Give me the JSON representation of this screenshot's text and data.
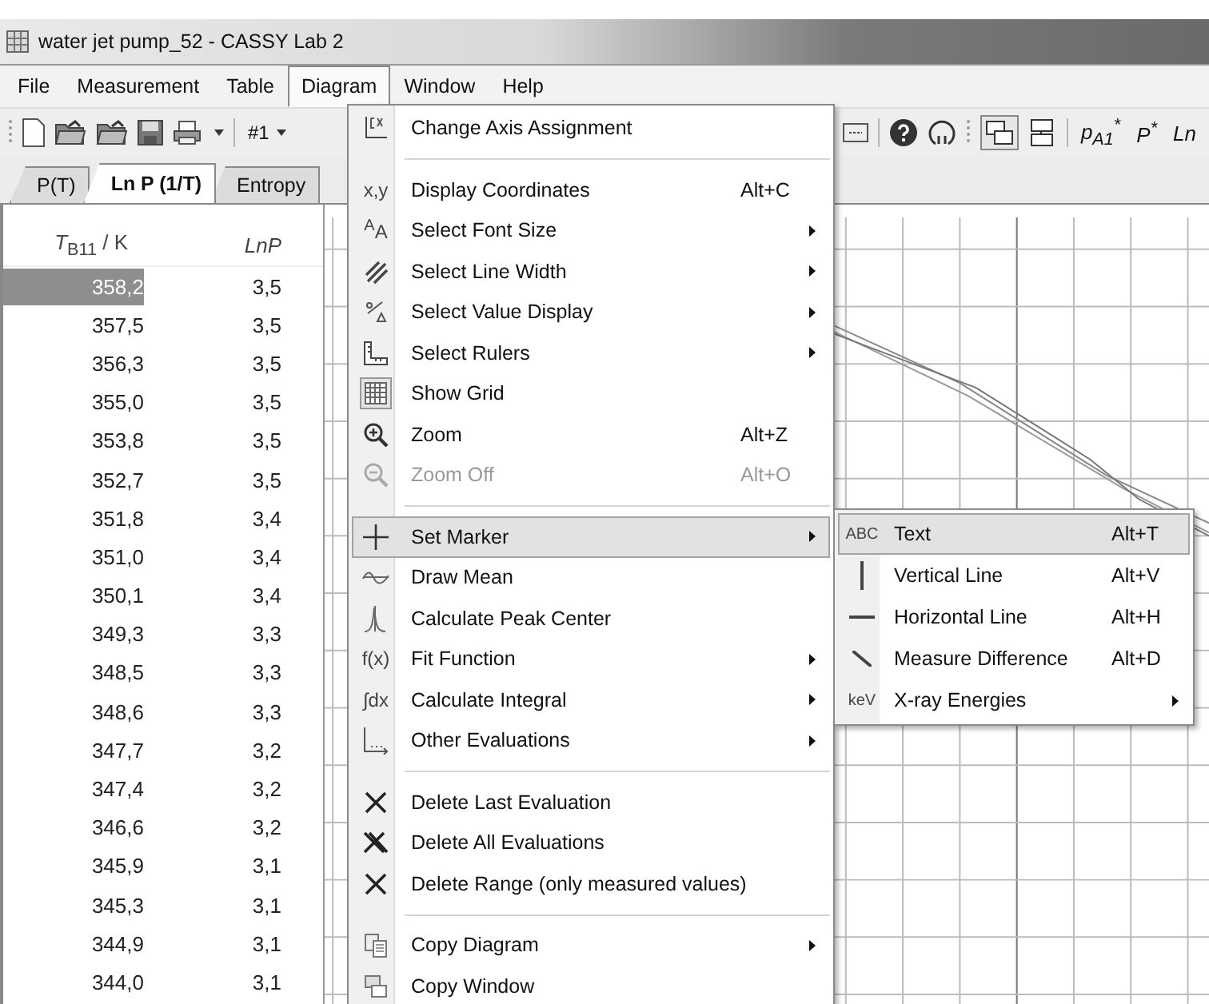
{
  "window": {
    "title": "water jet pump_52 - CASSY Lab 2"
  },
  "menu_bar": [
    {
      "label": "File",
      "selected": false
    },
    {
      "label": "Measurement",
      "selected": false
    },
    {
      "label": "Table",
      "selected": false
    },
    {
      "label": "Diagram",
      "selected": true
    },
    {
      "label": "Window",
      "selected": false
    },
    {
      "label": "Help",
      "selected": false
    }
  ],
  "toolbar": {
    "set_selector": "#1",
    "quantities": [
      "p$_{A1}$$^{*}$",
      "P$^{*}$",
      "Ln"
    ]
  },
  "tabs": [
    {
      "label": "P(T)",
      "selected": false
    },
    {
      "label": "Ln P (1/T)",
      "selected": true
    },
    {
      "label": "Entropy",
      "selected": false
    }
  ],
  "table": {
    "columns": [
      {
        "label": "*T*$_{B11}$ / K",
        "italic": false
      },
      {
        "label": "LnP",
        "italic": true
      }
    ],
    "rows": [
      {
        "cells": [
          "358,2",
          "3,5"
        ],
        "selected": true
      },
      {
        "cells": [
          "357,5",
          "3,5"
        ],
        "selected": false
      },
      {
        "cells": [
          "356,3",
          "3,5"
        ],
        "selected": false
      },
      {
        "cells": [
          "355,0",
          "3,5"
        ],
        "selected": false
      },
      {
        "cells": [
          "353,8",
          "3,5"
        ],
        "selected": false
      },
      {
        "cells": [
          "352,7",
          "3,5"
        ],
        "selected": false
      },
      {
        "cells": [
          "351,8",
          "3,4"
        ],
        "selected": false
      },
      {
        "cells": [
          "351,0",
          "3,4"
        ],
        "selected": false
      },
      {
        "cells": [
          "350,1",
          "3,4"
        ],
        "selected": false
      },
      {
        "cells": [
          "349,3",
          "3,3"
        ],
        "selected": false
      },
      {
        "cells": [
          "348,5",
          "3,3"
        ],
        "selected": false
      },
      {
        "cells": [
          "348,6",
          "3,3"
        ],
        "selected": false
      },
      {
        "cells": [
          "347,7",
          "3,2"
        ],
        "selected": false
      },
      {
        "cells": [
          "347,4",
          "3,2"
        ],
        "selected": false
      },
      {
        "cells": [
          "346,6",
          "3,2"
        ],
        "selected": false
      },
      {
        "cells": [
          "345,9",
          "3,1"
        ],
        "selected": false
      },
      {
        "cells": [
          "345,3",
          "3,1"
        ],
        "selected": false
      },
      {
        "cells": [
          "344,9",
          "3,1"
        ],
        "selected": false
      },
      {
        "cells": [
          "344,0",
          "3,1"
        ],
        "selected": false
      }
    ]
  },
  "diagram_menu": {
    "items": [
      {
        "kind": "item",
        "label": "Change Axis Assignment",
        "submenu": false,
        "disabled": false,
        "checked": false,
        "selected": false
      },
      {
        "kind": "separator"
      },
      {
        "kind": "item",
        "label": "Display Coordinates",
        "icon_text": "x,y",
        "shortcut": "Alt+C",
        "submenu": false,
        "disabled": false,
        "checked": false,
        "selected": false
      },
      {
        "kind": "item",
        "label": "Select Font Size",
        "icon_text": "$^{A}$A",
        "submenu": true,
        "disabled": false,
        "checked": false,
        "selected": false
      },
      {
        "kind": "item",
        "label": "Select Line Width",
        "submenu": true,
        "disabled": false,
        "checked": false,
        "selected": false
      },
      {
        "kind": "item",
        "label": "Select Value Display",
        "submenu": true,
        "disabled": false,
        "checked": false,
        "selected": false
      },
      {
        "kind": "item",
        "label": "Select Rulers",
        "submenu": true,
        "disabled": false,
        "checked": false,
        "selected": false
      },
      {
        "kind": "item",
        "label": "Show Grid",
        "submenu": false,
        "disabled": false,
        "checked": true,
        "selected": false
      },
      {
        "kind": "item",
        "label": "Zoom",
        "shortcut": "Alt+Z",
        "submenu": false,
        "disabled": false,
        "checked": false,
        "selected": false
      },
      {
        "kind": "item",
        "label": "Zoom Off",
        "shortcut": "Alt+O",
        "submenu": false,
        "disabled": true,
        "checked": false,
        "selected": false
      },
      {
        "kind": "separator"
      },
      {
        "kind": "item",
        "label": "Set Marker",
        "submenu": true,
        "disabled": false,
        "checked": false,
        "selected": true
      },
      {
        "kind": "item",
        "label": "Draw Mean",
        "submenu": false,
        "disabled": false,
        "checked": false,
        "selected": false
      },
      {
        "kind": "item",
        "label": "Calculate Peak Center",
        "submenu": false,
        "disabled": false,
        "checked": false,
        "selected": false
      },
      {
        "kind": "item",
        "label": "Fit Function",
        "icon_text": "f(x)",
        "submenu": true,
        "disabled": false,
        "checked": false,
        "selected": false
      },
      {
        "kind": "item",
        "label": "Calculate Integral",
        "icon_text": "∫dx",
        "submenu": true,
        "disabled": false,
        "checked": false,
        "selected": false
      },
      {
        "kind": "item",
        "label": "Other Evaluations",
        "submenu": true,
        "disabled": false,
        "checked": false,
        "selected": false
      },
      {
        "kind": "separator"
      },
      {
        "kind": "item",
        "label": "Delete Last Evaluation",
        "submenu": false,
        "disabled": false,
        "checked": false,
        "selected": false
      },
      {
        "kind": "item",
        "label": "Delete All Evaluations",
        "submenu": false,
        "disabled": false,
        "checked": false,
        "selected": false
      },
      {
        "kind": "item",
        "label": "Delete Range (only measured values)",
        "submenu": false,
        "disabled": false,
        "checked": false,
        "selected": false
      },
      {
        "kind": "separator"
      },
      {
        "kind": "item",
        "label": "Copy Diagram",
        "submenu": true,
        "disabled": false,
        "checked": false,
        "selected": false
      },
      {
        "kind": "item",
        "label": "Copy Window",
        "submenu": false,
        "disabled": false,
        "checked": false,
        "selected": false
      }
    ]
  },
  "marker_submenu": {
    "items": [
      {
        "label": "Text",
        "icon_text": "ABC",
        "shortcut": "Alt+T",
        "submenu": false,
        "selected": true
      },
      {
        "label": "Vertical Line",
        "shortcut": "Alt+V",
        "submenu": false,
        "selected": false
      },
      {
        "label": "Horizontal Line",
        "shortcut": "Alt+H",
        "submenu": false,
        "selected": false
      },
      {
        "label": "Measure Difference",
        "shortcut": "Alt+D",
        "submenu": false,
        "selected": false
      },
      {
        "label": "X-ray Energies",
        "icon_text": "keV",
        "submenu": true,
        "selected": false
      }
    ]
  }
}
